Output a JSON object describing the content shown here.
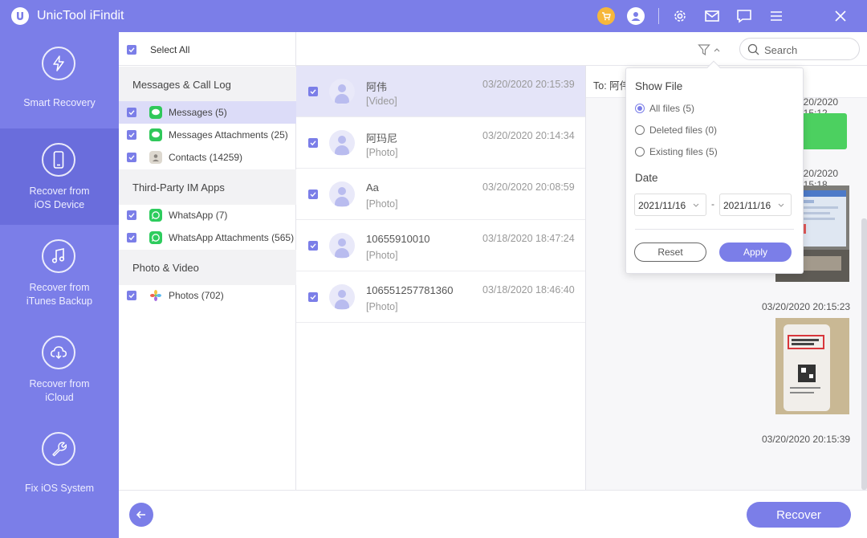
{
  "app": {
    "title": "UnicTool iFindit"
  },
  "titlebar_icons": [
    "cart-icon",
    "user-icon",
    "gear-icon",
    "mail-icon",
    "feedback-icon",
    "menu-icon",
    "close-icon"
  ],
  "sidebar": {
    "items": [
      {
        "line1": "Smart Recovery",
        "line2": "",
        "icon": "lightning-icon",
        "active": false
      },
      {
        "line1": "Recover from",
        "line2": "iOS Device",
        "icon": "phone-icon",
        "active": true
      },
      {
        "line1": "Recover from",
        "line2": "iTunes Backup",
        "icon": "music-icon",
        "active": false
      },
      {
        "line1": "Recover from",
        "line2": "iCloud",
        "icon": "cloud-icon",
        "active": false
      },
      {
        "line1": "Fix iOS System",
        "line2": "",
        "icon": "wrench-icon",
        "active": false
      }
    ]
  },
  "categories": {
    "select_all": "Select All",
    "groups": [
      {
        "title": "Messages & Call Log",
        "items": [
          {
            "label": "Messages (5)",
            "icon": "messages-icon",
            "active": true
          },
          {
            "label": "Messages Attachments (25)",
            "icon": "attachment-icon",
            "active": false
          },
          {
            "label": "Contacts (14259)",
            "icon": "contacts-icon",
            "active": false
          }
        ]
      },
      {
        "title": "Third-Party IM Apps",
        "items": [
          {
            "label": "WhatsApp (7)",
            "icon": "whatsapp-icon",
            "active": false
          },
          {
            "label": "WhatsApp Attachments (565)",
            "icon": "whatsapp-attachment-icon",
            "active": false
          }
        ]
      },
      {
        "title": "Photo & Video",
        "items": [
          {
            "label": "Photos (702)",
            "icon": "photos-icon",
            "active": false
          }
        ]
      }
    ]
  },
  "toolbar": {
    "search_placeholder": "Search"
  },
  "messages": [
    {
      "name": "阿伟",
      "type": "[Video]",
      "time": "03/20/2020 20:15:39",
      "active": true
    },
    {
      "name": "阿玛尼",
      "type": "[Photo]",
      "time": "03/20/2020 20:14:34",
      "active": false
    },
    {
      "name": "Aa",
      "type": "[Photo]",
      "time": "03/20/2020 20:08:59",
      "active": false
    },
    {
      "name": "10655910010",
      "type": "[Photo]",
      "time": "03/18/2020 18:47:24",
      "active": false
    },
    {
      "name": "106551257781360",
      "type": "[Photo]",
      "time": "03/18/2020 18:46:40",
      "active": false
    }
  ],
  "detail": {
    "to_label": "To: 阿伟",
    "timestamps": [
      "03/20/2020 20:15:12",
      "03/20/2020 20:15:18",
      "03/20/2020 20:15:23",
      "03/20/2020 20:15:39"
    ]
  },
  "filter": {
    "show_file_title": "Show File",
    "options": [
      {
        "label": "All files (5)",
        "checked": true
      },
      {
        "label": "Deleted files (0)",
        "checked": false
      },
      {
        "label": "Existing files (5)",
        "checked": false
      }
    ],
    "date_title": "Date",
    "date_from": "2021/11/16",
    "date_separator": "-",
    "date_to": "2021/11/16",
    "reset_label": "Reset",
    "apply_label": "Apply"
  },
  "footer": {
    "recover_label": "Recover",
    "back_icon": "back-arrow-icon"
  },
  "colors": {
    "accent": "#7b7ee8",
    "accent_dark": "#6a6ddc",
    "whatsapp_green": "#2dcc5d",
    "cart_orange": "#f6b73c"
  }
}
